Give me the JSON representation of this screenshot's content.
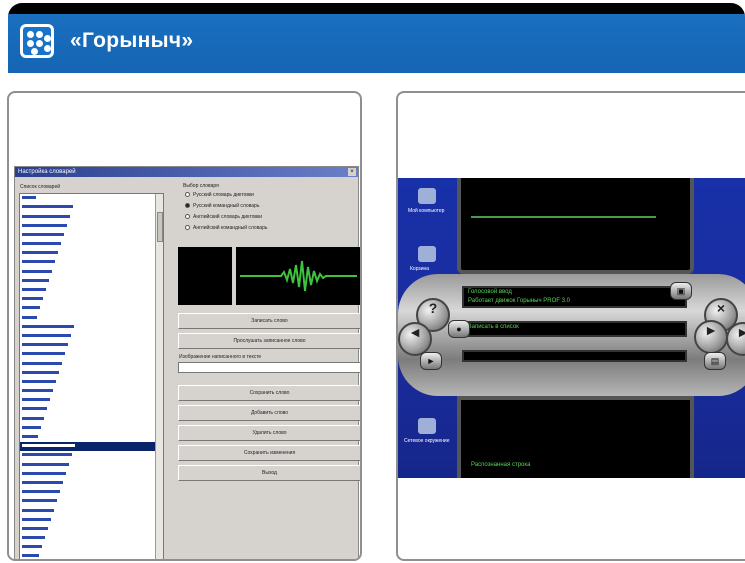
{
  "header": {
    "title": "«Горыныч»",
    "brand_color": "#1565b3",
    "logo_icon": "dots-grid-icon"
  },
  "left_screenshot": {
    "dialog_title": "Настройка словарей",
    "dictionary_list_label": "Список словарей",
    "dictionary_select_label": "Выбор словаря",
    "dictionaries": [
      "Русский словарь диктовки",
      "Русский командный словарь",
      "Английский словарь диктовки",
      "Английский командный словарь"
    ],
    "selected_dictionary_index": 1,
    "buttons": {
      "record": "Записать слово",
      "play": "Прослушать записанное слово",
      "change": "Сохранить слово",
      "add": "Добавить слово",
      "delete": "Удалить слово",
      "save": "Сохранить изменения",
      "exit": "Выход"
    },
    "word_field_label": "Изображение написанного в тексте"
  },
  "right_screenshot": {
    "lcd_line1": "Голосовой ввод",
    "lcd_line2": "Работает движок Горыныч PROF 3.0",
    "lcd_status": "Записать в список",
    "bottom_status": "Распознанная строка",
    "desktop_icons": [
      "Мой компьютер",
      "Корзина",
      "Сетевое окружение"
    ],
    "side_left_top": "?",
    "side_right_top": "×",
    "arrow_left": "◄",
    "arrow_right": "►"
  }
}
